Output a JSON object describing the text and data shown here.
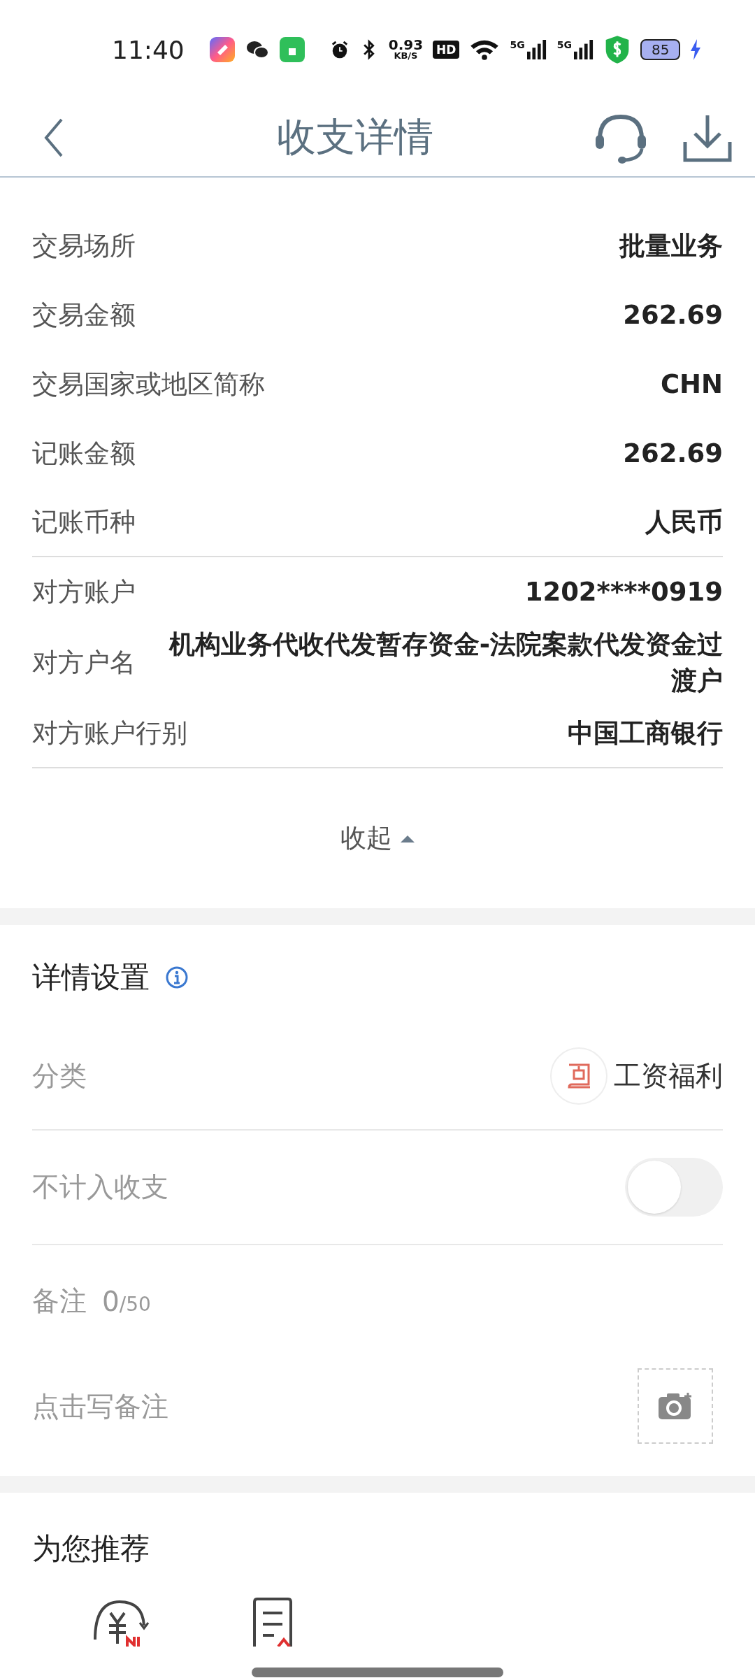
{
  "status_bar": {
    "time": "11:40",
    "net_speed": "0.93",
    "net_unit": "KB/S",
    "hd": "HD",
    "signals": [
      "5G",
      "5G"
    ],
    "battery": "85"
  },
  "header": {
    "title": "收支详情"
  },
  "details": [
    {
      "label": "交易场所",
      "value": "批量业务",
      "divider": false
    },
    {
      "label": "交易金额",
      "value": "262.69",
      "divider": false
    },
    {
      "label": "交易国家或地区简称",
      "value": "CHN",
      "divider": false
    },
    {
      "label": "记账金额",
      "value": "262.69",
      "divider": false
    },
    {
      "label": "记账币种",
      "value": "人民币",
      "divider": true
    },
    {
      "label": "对方账户",
      "value": "1202****0919",
      "divider": false
    },
    {
      "label": "对方户名",
      "value": "机构业务代收代发暂存资金-法院案款代发资金过渡户",
      "divider": false
    },
    {
      "label": "对方账户行别",
      "value": "中国工商银行",
      "divider": true
    }
  ],
  "collapse": {
    "label": "收起"
  },
  "settings": {
    "title": "详情设置",
    "category": {
      "label": "分类",
      "value": "工资福利"
    },
    "exclude": {
      "label": "不计入收支",
      "on": false
    },
    "note": {
      "label": "备注",
      "count": "0",
      "limit": "/50",
      "placeholder": "点击写备注"
    }
  },
  "recommend": {
    "title": "为您推荐"
  }
}
